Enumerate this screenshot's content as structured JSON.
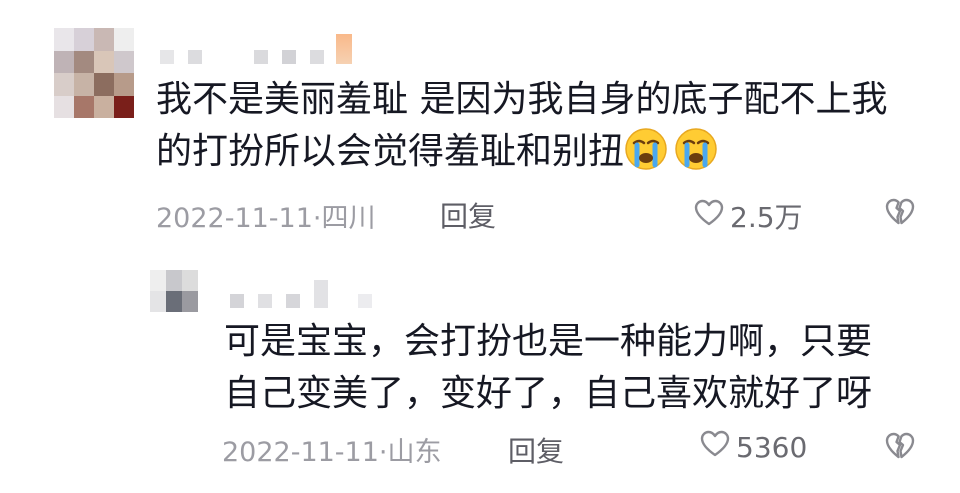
{
  "comment": {
    "text_line1": "我不是美丽羞耻 是因为我自身的底子配不上我",
    "text_line2": "的打扮所以会觉得羞耻和别扭",
    "emoji": [
      "crying-face",
      "crying-face"
    ],
    "date": "2022-11-11",
    "location": "四川",
    "reply_label": "回复",
    "likes": "2.5万"
  },
  "reply": {
    "text_line1": "可是宝宝，会打扮也是一种能力啊，只要",
    "text_line2": "自己变美了，变好了，自己喜欢就好了呀",
    "date": "2022-11-11",
    "location": "山东",
    "reply_label": "回复",
    "likes": "5360"
  },
  "icons": {
    "like": "heart-outline-icon",
    "dislike": "broken-heart-icon"
  },
  "colors": {
    "text": "#161823",
    "meta": "#9c9ca3",
    "reply_link": "#5e5e66",
    "icon": "#8a8a90"
  }
}
